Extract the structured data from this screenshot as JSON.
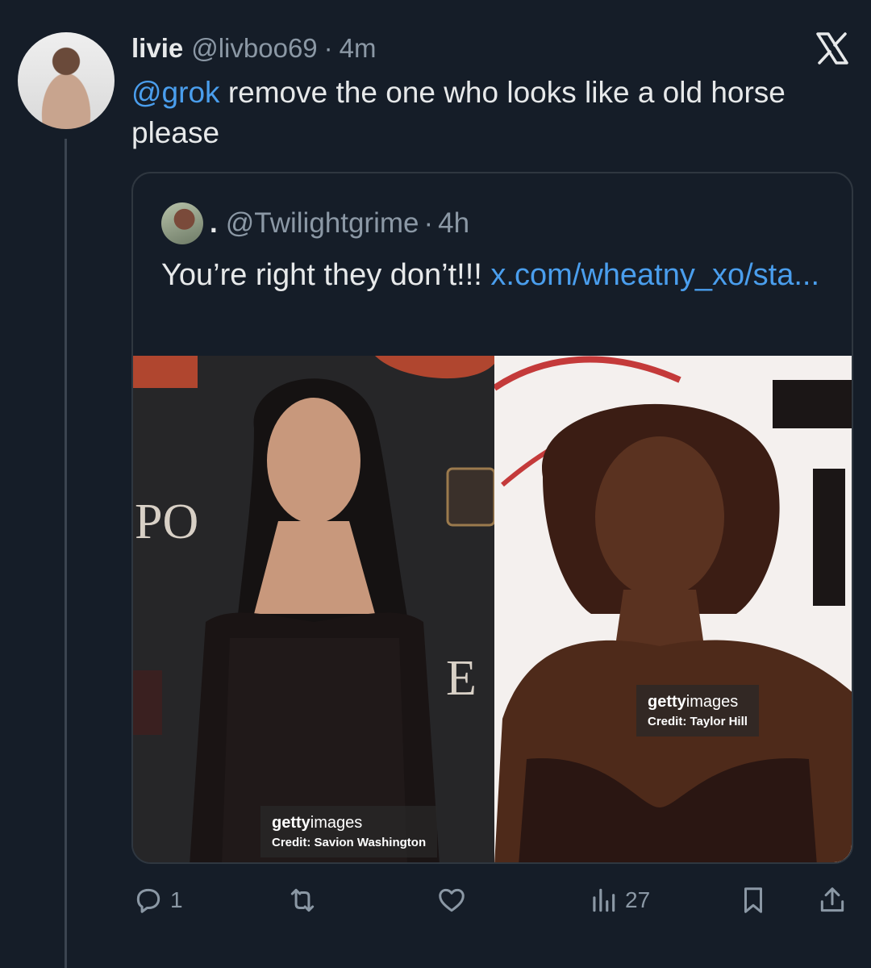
{
  "tweet": {
    "display_name": "livie",
    "handle": "@livboo69",
    "separator": "·",
    "time": "4m",
    "mention": "@grok",
    "text": "remove the one who looks like a old horse please"
  },
  "quote": {
    "display_name": ".",
    "handle": "@Twilightgrime",
    "separator": "·",
    "time": "4h",
    "text": "You’re right they don’t!!!",
    "link": "x.com/wheatny_xo/sta..."
  },
  "media": {
    "left": {
      "watermark_brand_bold": "getty",
      "watermark_brand": "images",
      "credit": "Credit: Savion Washington",
      "backdrop_text": "PO"
    },
    "right": {
      "watermark_brand_bold": "getty",
      "watermark_brand": "images",
      "credit": "Credit: Taylor Hill"
    }
  },
  "actions": {
    "reply_count": "1",
    "repost_count": "",
    "like_count": "",
    "views_count": "27"
  },
  "colors": {
    "background": "#151d28",
    "accent": "#4a9eed",
    "muted": "#8b98a5",
    "text": "#e7e9ea"
  },
  "icons": [
    "x-logo-icon",
    "reply-icon",
    "repost-icon",
    "like-icon",
    "views-icon",
    "bookmark-icon",
    "share-icon"
  ]
}
